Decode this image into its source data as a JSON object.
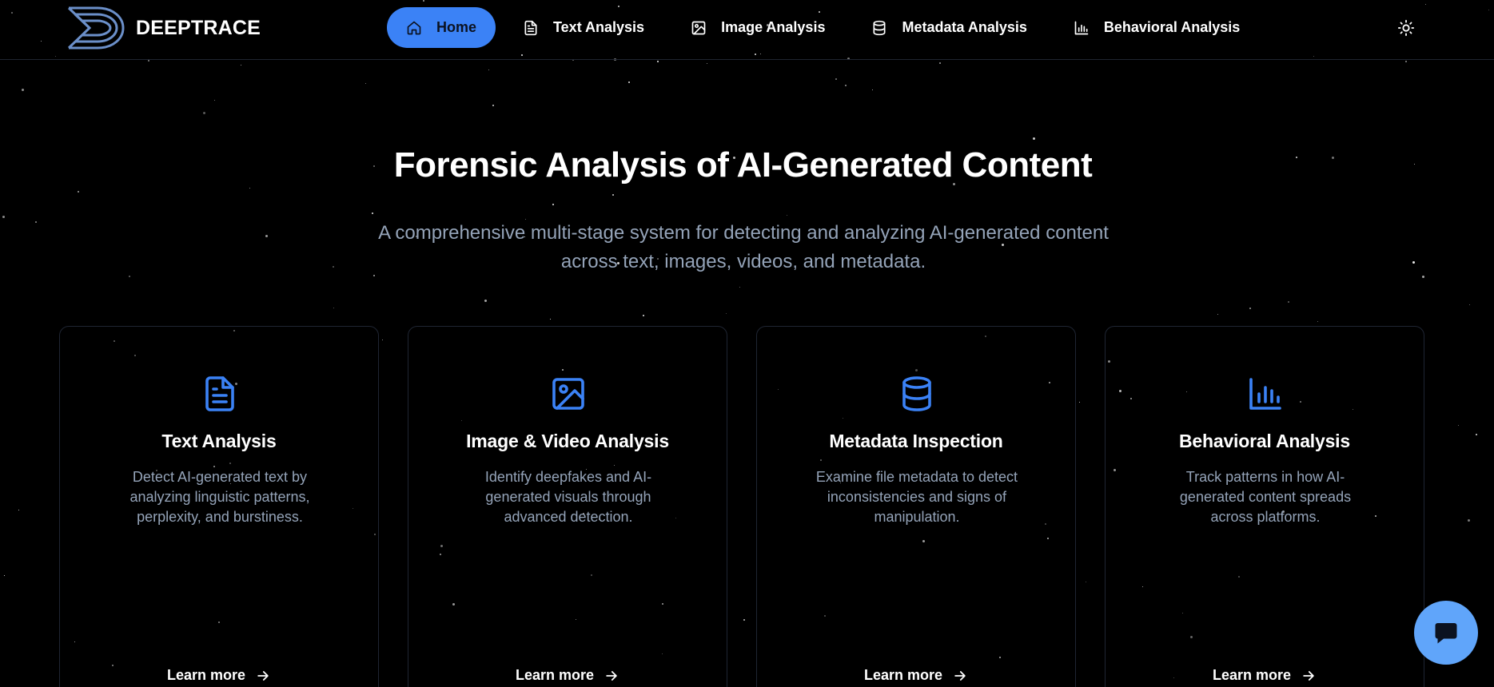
{
  "brand": {
    "name": "DEEPTRACE"
  },
  "nav": {
    "items": [
      {
        "label": "Home",
        "icon": "home-icon",
        "active": true
      },
      {
        "label": "Text Analysis",
        "icon": "document-icon"
      },
      {
        "label": "Image Analysis",
        "icon": "image-icon"
      },
      {
        "label": "Metadata Analysis",
        "icon": "database-icon"
      },
      {
        "label": "Behavioral Analysis",
        "icon": "bar-chart-icon"
      }
    ],
    "theme_toggle_icon": "sun-icon"
  },
  "hero": {
    "title": "Forensic Analysis of AI-Generated Content",
    "subtitle": "A comprehensive multi-stage system for detecting and analyzing AI-generated content across text, images, videos, and metadata."
  },
  "cards": [
    {
      "title": "Text Analysis",
      "description": "Detect AI-generated text by analyzing linguistic patterns, perplexity, and burstiness.",
      "link": "Learn more",
      "icon": "document-icon"
    },
    {
      "title": "Image & Video Analysis",
      "description": "Identify deepfakes and AI-generated visuals through advanced detection.",
      "link": "Learn more",
      "icon": "image-icon"
    },
    {
      "title": "Metadata Inspection",
      "description": "Examine file metadata to detect inconsistencies and signs of manipulation.",
      "link": "Learn more",
      "icon": "database-icon"
    },
    {
      "title": "Behavioral Analysis",
      "description": "Track patterns in how AI-generated content spreads across platforms.",
      "link": "Learn more",
      "icon": "bar-chart-icon"
    }
  ],
  "chat": {
    "icon": "chat-bubble-icon"
  },
  "colors": {
    "accent": "#3b82f6",
    "chat": "#60a5fa",
    "muted_text": "#94a3b8",
    "background": "#000000"
  }
}
